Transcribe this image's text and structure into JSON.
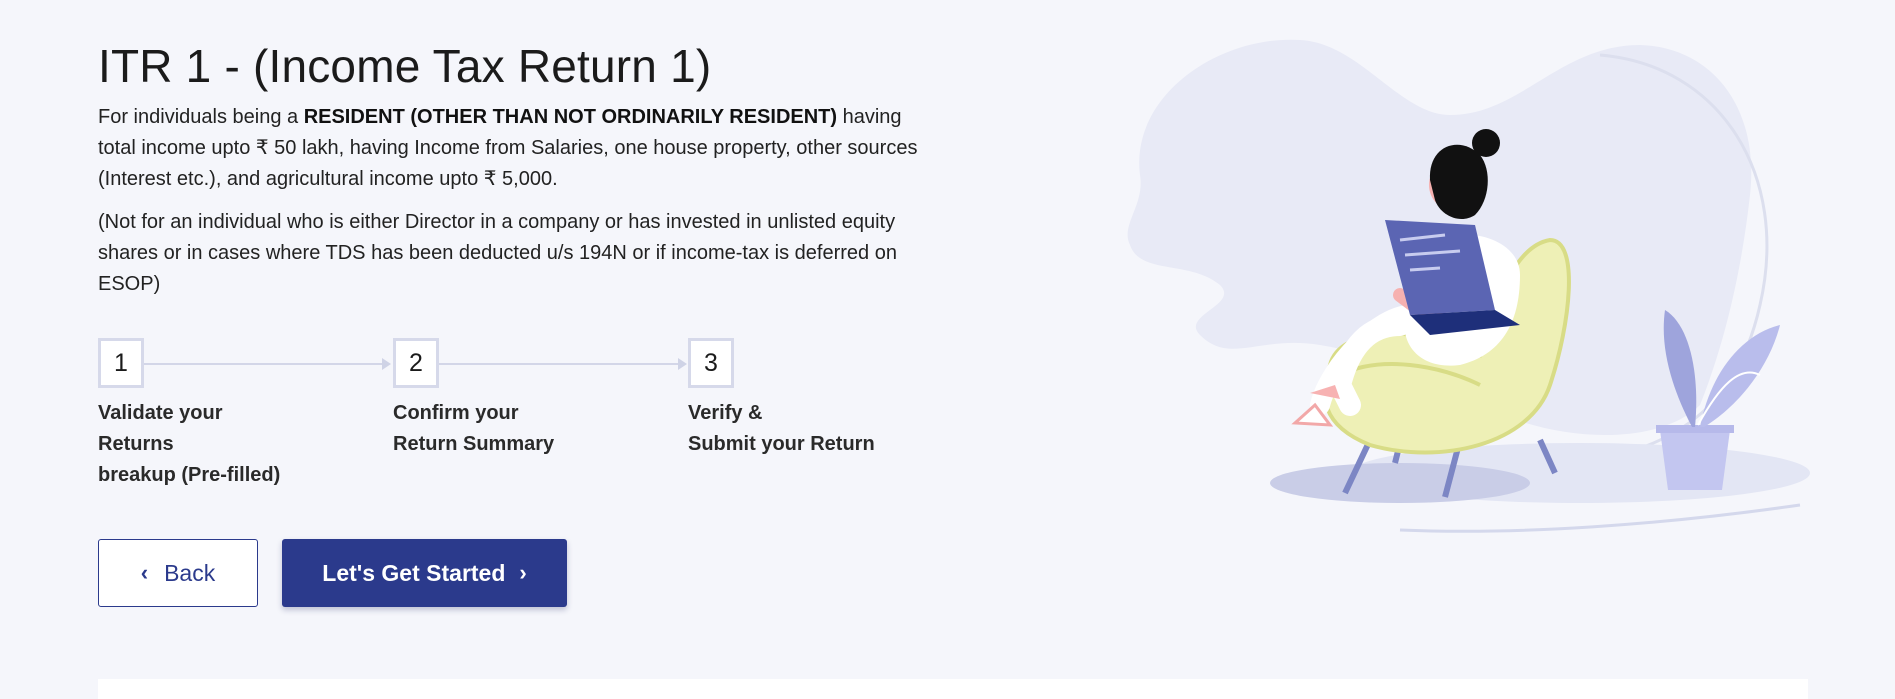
{
  "page": {
    "title": "ITR 1 - (Income Tax Return 1)",
    "description_prefix": "For individuals being a ",
    "description_bold": "RESIDENT (OTHER THAN NOT ORDINARILY RESIDENT)",
    "description_rest": " having total income upto ₹ 50 lakh, having Income from Salaries, one house property, other sources (Interest etc.), and agricultural income upto ₹ 5,000.",
    "note": "(Not for an individual who is either Director in a company or has invested in unlisted equity shares or in cases where TDS has been deducted u/s 194N or if income-tax is deferred on ESOP)"
  },
  "steps": [
    {
      "number": "1",
      "label_lines": [
        "Validate your",
        "Returns",
        "breakup (Pre-filled)"
      ]
    },
    {
      "number": "2",
      "label_lines": [
        "Confirm your",
        "Return Summary"
      ]
    },
    {
      "number": "3",
      "label_lines": [
        "Verify &",
        "Submit your Return"
      ]
    }
  ],
  "buttons": {
    "back_label": "Back",
    "start_label": "Let's Get Started"
  },
  "colors": {
    "primary": "#2b3a8c",
    "background": "#f5f6fb",
    "step_border": "#d6d9ea"
  },
  "icons": {
    "back": "chevron-left-icon",
    "start": "chevron-right-icon",
    "illustration": "woman-with-laptop-illustration"
  }
}
